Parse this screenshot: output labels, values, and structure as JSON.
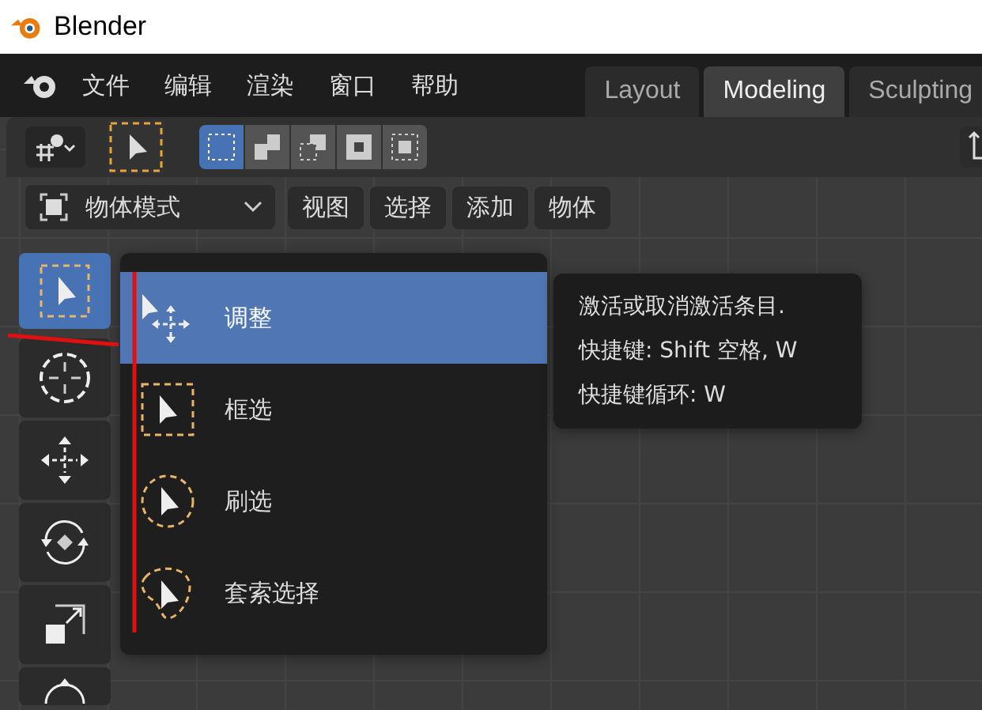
{
  "window": {
    "title": "Blender"
  },
  "menu": [
    "文件",
    "编辑",
    "渲染",
    "窗口",
    "帮助"
  ],
  "workspace_tabs": [
    {
      "label": "Layout",
      "selected": false
    },
    {
      "label": "Modeling",
      "selected": true
    },
    {
      "label": "Sculpting",
      "selected": false
    }
  ],
  "select_modes": [
    {
      "selected": true
    },
    {
      "selected": false
    },
    {
      "selected": false
    },
    {
      "selected": false
    },
    {
      "selected": false
    }
  ],
  "mode_dropdown": "物体模式",
  "view_menus": [
    "视图",
    "选择",
    "添加",
    "物体"
  ],
  "toolbar": [
    {
      "kind": "select",
      "selected": true
    },
    {
      "kind": "cursor",
      "selected": false
    },
    {
      "kind": "move",
      "selected": false
    },
    {
      "kind": "rotate",
      "selected": false
    },
    {
      "kind": "scale",
      "selected": false
    },
    {
      "kind": "transform",
      "selected": false
    }
  ],
  "tool_menu": [
    {
      "kind": "tweak",
      "label": "调整",
      "selected": true
    },
    {
      "kind": "box",
      "label": "框选",
      "selected": false
    },
    {
      "kind": "circle",
      "label": "刷选",
      "selected": false
    },
    {
      "kind": "lasso",
      "label": "套索选择",
      "selected": false
    }
  ],
  "tooltip": [
    "激活或取消激活条目.",
    "快捷键: Shift 空格, W",
    "快捷键循环: W"
  ]
}
